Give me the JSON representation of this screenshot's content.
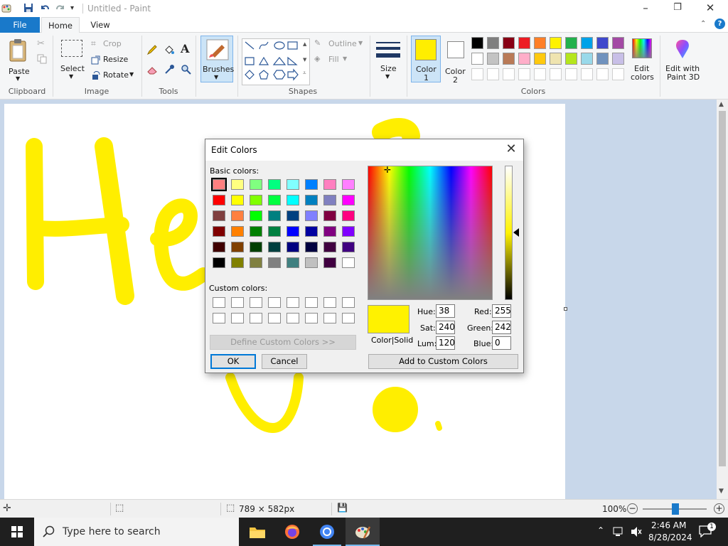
{
  "window": {
    "title": "Untitled - Paint",
    "minimize": "–",
    "restore": "❐",
    "close": "✕"
  },
  "tabs": {
    "file": "File",
    "home": "Home",
    "view": "View"
  },
  "ribbon": {
    "clipboard": {
      "label": "Clipboard",
      "paste": "Paste"
    },
    "image": {
      "label": "Image",
      "select": "Select",
      "crop": "Crop",
      "resize": "Resize",
      "rotate": "Rotate"
    },
    "tools": {
      "label": "Tools"
    },
    "brushes": "Brushes",
    "shapes": {
      "label": "Shapes",
      "outline": "Outline",
      "fill": "Fill"
    },
    "size": "Size",
    "color1": {
      "label1": "Color",
      "label2": "1",
      "color": "#ffee00"
    },
    "color2": {
      "label1": "Color",
      "label2": "2",
      "color": "#ffffff"
    },
    "colors": {
      "label": "Colors",
      "row1": [
        "#000000",
        "#7f7f7f",
        "#880015",
        "#ed1c24",
        "#ff7f27",
        "#fff200",
        "#22b14c",
        "#00a2e8",
        "#3f48cc",
        "#a349a4"
      ],
      "row2": [
        "#ffffff",
        "#c3c3c3",
        "#b97a57",
        "#ffaec9",
        "#ffc90e",
        "#efe4b0",
        "#b5e61d",
        "#99d9ea",
        "#7092be",
        "#c8bfe7"
      ]
    },
    "edit_colors": {
      "line1": "Edit",
      "line2": "colors"
    },
    "paint3d": {
      "line1": "Edit with",
      "line2": "Paint 3D"
    }
  },
  "canvas": {
    "paint_color": "#ffee00"
  },
  "status": {
    "dimensions": "789 × 582px",
    "zoom": "100%"
  },
  "taskbar": {
    "search_placeholder": "Type here to search",
    "time": "2:46 AM",
    "date": "8/28/2024",
    "notifications": "1"
  },
  "dialog": {
    "title": "Edit Colors",
    "basic_label": "Basic colors:",
    "custom_label": "Custom colors:",
    "define_custom": "Define Custom Colors >>",
    "ok": "OK",
    "cancel": "Cancel",
    "add_custom": "Add to Custom Colors",
    "color_solid": "Color|Solid",
    "preview_color": "#fff200",
    "hue_label": "Hue:",
    "hue": "38",
    "sat_label": "Sat:",
    "sat": "240",
    "lum_label": "Lum:",
    "lum": "120",
    "red_label": "Red:",
    "red": "255",
    "green_label": "Green:",
    "green": "242",
    "blue_label": "Blue:",
    "blue": "0",
    "basic_colors": [
      [
        "#ff8080",
        "#ffff80",
        "#80ff80",
        "#00ff80",
        "#80ffff",
        "#0080ff",
        "#ff80c0",
        "#ff80ff"
      ],
      [
        "#ff0000",
        "#ffff00",
        "#80ff00",
        "#00ff40",
        "#00ffff",
        "#0080c0",
        "#8080c0",
        "#ff00ff"
      ],
      [
        "#804040",
        "#ff8040",
        "#00ff00",
        "#008080",
        "#004080",
        "#8080ff",
        "#800040",
        "#ff0080"
      ],
      [
        "#800000",
        "#ff8000",
        "#008000",
        "#008040",
        "#0000ff",
        "#0000a0",
        "#800080",
        "#8000ff"
      ],
      [
        "#400000",
        "#804000",
        "#004000",
        "#004040",
        "#000080",
        "#000040",
        "#400040",
        "#400080"
      ],
      [
        "#000000",
        "#808000",
        "#808040",
        "#808080",
        "#408080",
        "#c0c0c0",
        "#400040",
        "#ffffff"
      ]
    ]
  }
}
